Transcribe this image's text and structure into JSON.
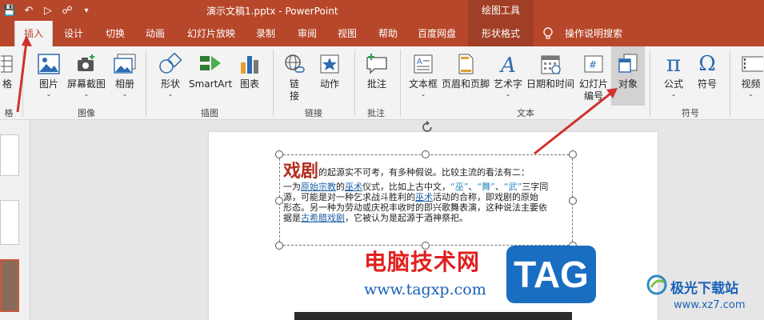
{
  "titlebar": {
    "doc_title": "演示文稿1.pptx  -  PowerPoint",
    "context_title": "绘图工具",
    "qat_icons": [
      "save-icon",
      "undo-icon",
      "start-slideshow-icon",
      "print-preview-icon",
      "customize-qat-icon"
    ]
  },
  "tabs": [
    {
      "label": "插入",
      "active": true
    },
    {
      "label": "设计"
    },
    {
      "label": "切换"
    },
    {
      "label": "动画"
    },
    {
      "label": "幻灯片放映"
    },
    {
      "label": "录制"
    },
    {
      "label": "审阅"
    },
    {
      "label": "视图"
    },
    {
      "label": "帮助"
    },
    {
      "label": "百度网盘"
    },
    {
      "label": "形状格式"
    },
    {
      "label": "操作说明搜索"
    }
  ],
  "ribbon": {
    "buttons": {
      "table_partial": "格",
      "picture": "图片",
      "screenshot": "屏幕截图",
      "album": "相册",
      "shapes": "形状",
      "smartart": "SmartArt",
      "chart": "图表",
      "link_1": "链",
      "link_2": "接",
      "action": "动作",
      "comment": "批注",
      "textbox": "文本框",
      "header_footer": "页眉和页脚",
      "wordart": "艺术字",
      "datetime": "日期和时间",
      "slidenum_1": "幻灯片",
      "slidenum_2": "编号",
      "object": "对象",
      "equation": "公式",
      "symbol": "符号",
      "video": "视频"
    },
    "groups": {
      "table_partial": "格",
      "images": "图像",
      "illustrations": "插图",
      "links": "链接",
      "comments": "批注",
      "text": "文本",
      "symbols": "符号"
    }
  },
  "slide": {
    "heading": "戏剧",
    "line1_rest": "的起源实不可考，有多种假说。比较主流的看法有二：",
    "l2a": "一为",
    "l2_link1": "原始宗教",
    "l2b": "的",
    "l2_link2": "巫术",
    "l2c": "仪式，比如上古中文，",
    "l2_q1": "“巫”",
    "l2d": "、",
    "l2_q2": "“舞”",
    "l2e": "、",
    "l2_q3": "“武”",
    "l2f": "三字同",
    "l3a": "源，可能是对一种乞求战斗胜利的",
    "l3_link": "巫术",
    "l3b": "活动的合称，即戏剧的原始",
    "l4": "形态。另一种为劳动或庆祝丰收时的即兴歌舞表演，这种说法主要依",
    "l5a": "据是",
    "l5_link": "古希腊戏剧",
    "l5b": "，它被认为是起源于酒神祭祀。"
  },
  "watermarks": {
    "site_cn": "电脑技术网",
    "site_url": "www.tagxp.com",
    "tag": "TAG",
    "site2_cn": "极光下载站",
    "site2_url": "www.xz7.com"
  },
  "colors": {
    "accent": "#b7472a",
    "annotation_arrow": "#d0312d"
  }
}
